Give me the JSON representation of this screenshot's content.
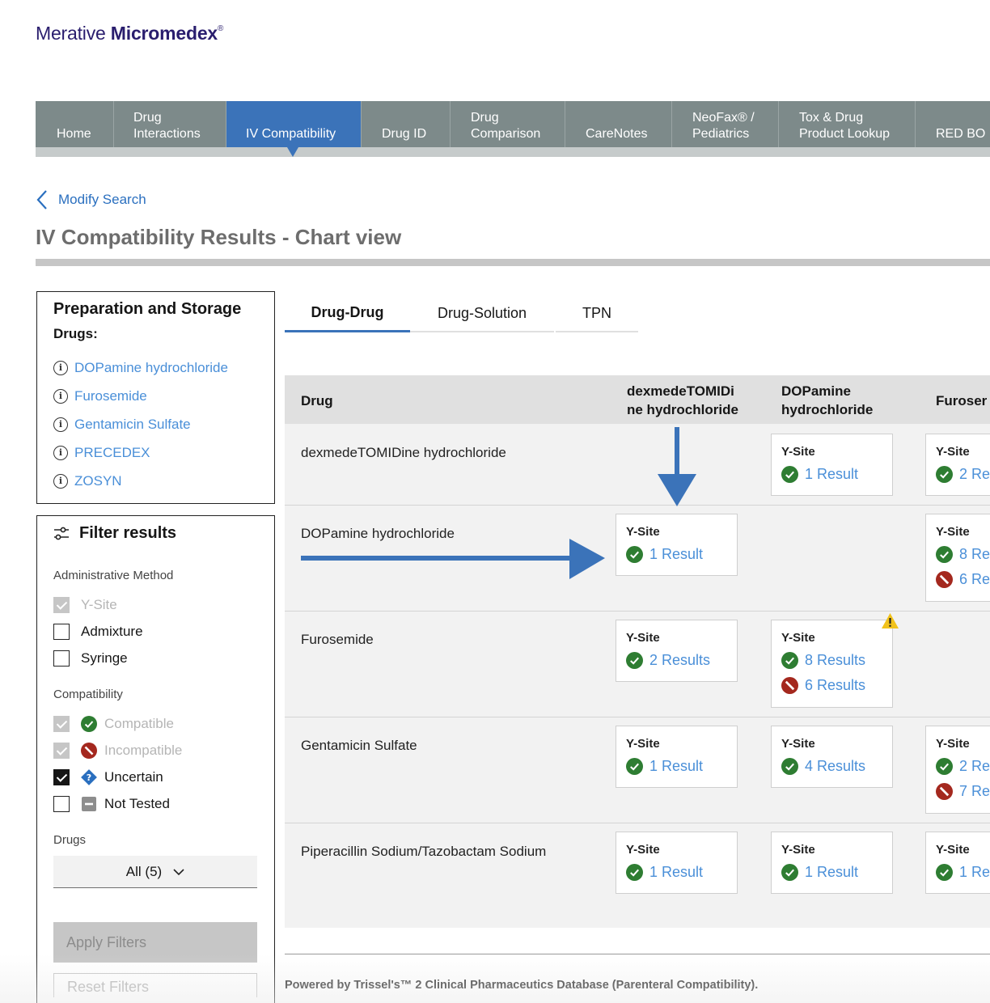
{
  "logo": {
    "light": "Merative",
    "bold": "Micromedex",
    "mark": "®"
  },
  "nav": [
    {
      "lines": [
        "Home"
      ],
      "active": false
    },
    {
      "lines": [
        "Drug",
        "Interactions"
      ],
      "active": false
    },
    {
      "lines": [
        "IV Compatibility"
      ],
      "active": true
    },
    {
      "lines": [
        "Drug ID"
      ],
      "active": false
    },
    {
      "lines": [
        "Drug",
        "Comparison"
      ],
      "active": false
    },
    {
      "lines": [
        "CareNotes"
      ],
      "active": false
    },
    {
      "lines": [
        "NeoFax® /",
        "Pediatrics"
      ],
      "active": false
    },
    {
      "lines": [
        "Tox & Drug",
        "Product Lookup"
      ],
      "active": false
    },
    {
      "lines": [
        "RED BO"
      ],
      "active": false
    }
  ],
  "modify_search": "Modify Search",
  "page_title": "IV Compatibility Results - Chart view",
  "prep": {
    "title": "Preparation and Storage",
    "drugs_label": "Drugs:",
    "drugs": [
      "DOPamine hydrochloride",
      "Furosemide",
      "Gentamicin Sulfate",
      "PRECEDEX",
      "ZOSYN"
    ]
  },
  "filter": {
    "title": "Filter results",
    "admin_label": "Administrative Method",
    "admin": [
      {
        "label": "Y-Site",
        "state": "disabled"
      },
      {
        "label": "Admixture",
        "state": "unchecked"
      },
      {
        "label": "Syringe",
        "state": "unchecked"
      }
    ],
    "compat_label": "Compatibility",
    "compat": [
      {
        "label": "Compatible",
        "state": "disabled",
        "icon": "compatible-icon"
      },
      {
        "label": "Incompatible",
        "state": "disabled",
        "icon": "incompatible-icon"
      },
      {
        "label": "Uncertain",
        "state": "checked",
        "icon": "uncertain-icon"
      },
      {
        "label": "Not Tested",
        "state": "unchecked",
        "icon": "not-tested-icon"
      }
    ],
    "drugs_label": "Drugs",
    "drugs_value": "All (5)",
    "apply": "Apply Filters",
    "reset": "Reset Filters"
  },
  "tabs": [
    "Drug-Drug",
    "Drug-Solution",
    "TPN"
  ],
  "grid": {
    "drug_header": "Drug",
    "columns": [
      [
        "dexmedeTOMIDi",
        "ne hydrochloride"
      ],
      [
        "DOPamine",
        "hydrochloride"
      ],
      [
        "Furoser"
      ]
    ],
    "rows": [
      "dexmedeTOMIDine hydrochloride",
      "DOPamine hydrochloride",
      "Furosemide",
      "Gentamicin Sulfate",
      "Piperacillin Sodium/Tazobactam Sodium"
    ],
    "method": "Y-Site",
    "cells": {
      "r0c1": [
        "1 Result"
      ],
      "r0c2": [
        "2 Re"
      ],
      "r1c0": [
        "1 Result"
      ],
      "r1c2a": "8 Re",
      "r1c2b": "6 Re",
      "r2c0": [
        "2 Results"
      ],
      "r2c1a": "8 Results",
      "r2c1b": "6 Results",
      "r3c0": [
        "1 Result"
      ],
      "r3c1": [
        "4 Results"
      ],
      "r3c2a": "2 Re",
      "r3c2b": "7 Re",
      "r4c0": [
        "1 Result"
      ],
      "r4c1": [
        "1 Result"
      ],
      "r4c2": [
        "1 Re"
      ]
    }
  },
  "footer": "Powered by  Trissel's™ 2 Clinical Pharmaceutics Database (Parenteral Compatibility).",
  "colors": {
    "nav": "#7d8a8a",
    "active": "#3b73b9",
    "link": "#4a8fd8",
    "compatible": "#2e7d32",
    "incompatible": "#a4281e",
    "warning": "#f1c21b"
  }
}
